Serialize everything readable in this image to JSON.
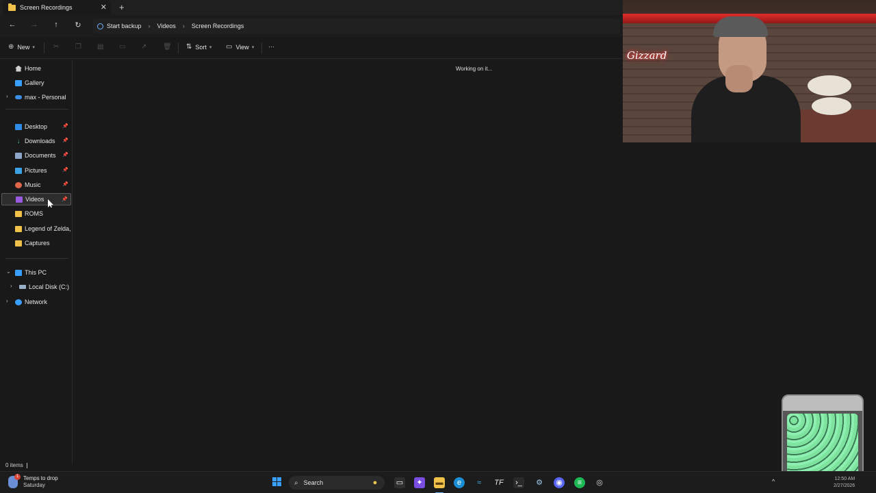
{
  "window": {
    "tab_title": "Screen Recordings",
    "tab_close": "✕",
    "new_tab": "+"
  },
  "nav": {
    "back": "←",
    "forward": "→",
    "up": "↑",
    "refresh": "↻",
    "breadcrumbs": [
      "Start backup",
      "Videos",
      "Screen Recordings"
    ],
    "sep": "›"
  },
  "commands": {
    "new_label": "New",
    "sort_label": "Sort",
    "view_label": "View",
    "more": "···"
  },
  "sidebar": {
    "items": [
      {
        "label": "Home",
        "icon": "home-icon"
      },
      {
        "label": "Gallery",
        "icon": "gallery-icon"
      },
      {
        "label": "max - Personal",
        "icon": "cloud-icon"
      },
      {
        "label": "Desktop",
        "icon": "desktop-icon"
      },
      {
        "label": "Downloads",
        "icon": "downloads-icon"
      },
      {
        "label": "Documents",
        "icon": "documents-icon"
      },
      {
        "label": "Pictures",
        "icon": "pictures-icon"
      },
      {
        "label": "Music",
        "icon": "music-icon"
      },
      {
        "label": "Videos",
        "icon": "videos-icon"
      },
      {
        "label": "ROMS",
        "icon": "folder-icon"
      },
      {
        "label": "Legend of Zelda, Tl",
        "icon": "folder-icon"
      },
      {
        "label": "Captures",
        "icon": "folder-icon"
      },
      {
        "label": "This PC",
        "icon": "pc-icon"
      },
      {
        "label": "Local Disk (C:)",
        "icon": "disk-icon"
      },
      {
        "label": "Network",
        "icon": "network-icon"
      }
    ],
    "selected": "Videos"
  },
  "main": {
    "status_message": "Working on it..."
  },
  "statusbar": {
    "items_count": "0 items"
  },
  "webcam": {
    "sign_text": "Gizzard"
  },
  "taskbar": {
    "weather_line1": "Temps to drop",
    "weather_line2": "Saturday",
    "search_label": "Search",
    "clock_time": "12:50 AM",
    "clock_date": "2/27/2026",
    "tray_chevron": "^"
  },
  "colors": {
    "accent": "#3aa0ff",
    "background": "#191919",
    "folder": "#f0c24a"
  }
}
